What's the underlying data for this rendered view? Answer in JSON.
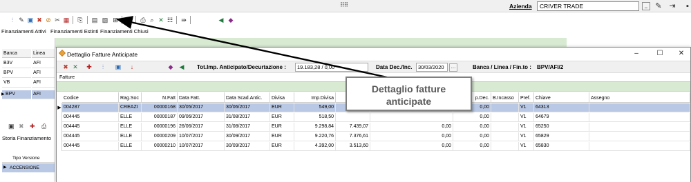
{
  "topbar": {
    "grip": "⠿⠿",
    "azienda_label": "Azienda",
    "azienda_value": "CRIVER TRADE",
    "dropdown_glyph": "_",
    "icons": [
      "edit-icon",
      "exit-icon",
      "more-icon"
    ]
  },
  "tabs": [
    "Finanziamenti Attivi",
    "Finanziamenti Estinti",
    "Finanziamenti Chiusi"
  ],
  "left_grid": {
    "headers": [
      "Banca",
      "Linea"
    ],
    "rows": [
      {
        "banca": "B3V",
        "linea": "AFI"
      },
      {
        "banca": "BPV",
        "linea": "AFI"
      },
      {
        "banca": "VB",
        "linea": "AFI"
      },
      {
        "banca": "BPV",
        "linea": "AFI"
      }
    ],
    "storia_label": "Storia Finanziamento",
    "tipo_header": "Tipo Versione",
    "tipo_value": "ACCENSIONE"
  },
  "dialog": {
    "title": "Dettaglio Fatture Anticipate",
    "tot_label": "Tot.Imp. Anticipato/Decurtazione :",
    "tot_value": "19.183,28 / 0,00",
    "data_label": "Data Dec./Inc.",
    "data_value": "30/03/2020",
    "banca_label": "Banca / Linea / Fin.to :",
    "banca_value": "BPV/AFI/2",
    "fatture_label": "Fatture",
    "columns": [
      "Codice",
      "Rag.Soc",
      "N.Fatt",
      "Data Fatt.",
      "Data Scad.Antic.",
      "Divisa",
      "Imp.Divisa",
      "",
      "",
      "p.Dec.",
      "B.Incasso",
      "Pref.",
      "Chiave",
      "Assegno"
    ],
    "rows": [
      {
        "codice": "004287",
        "ragsoc": "CREAZI",
        "nfatt": "00000168",
        "data_fatt": "30/05/2017",
        "data_scad": "30/06/2017",
        "divisa": "EUR",
        "imp_divisa": "549,00",
        "imp2": "",
        "imp3": "",
        "dec": "0,00",
        "pref": "V1",
        "chiave": "64313"
      },
      {
        "codice": "004445",
        "ragsoc": "ELLE",
        "nfatt": "00000187",
        "data_fatt": "09/06/2017",
        "data_scad": "31/08/2017",
        "divisa": "EUR",
        "imp_divisa": "518,50",
        "imp2": "",
        "imp3": "",
        "dec": "0,00",
        "pref": "V1",
        "chiave": "64679"
      },
      {
        "codice": "004445",
        "ragsoc": "ELLE",
        "nfatt": "00000196",
        "data_fatt": "26/06/2017",
        "data_scad": "31/08/2017",
        "divisa": "EUR",
        "imp_divisa": "9.298,84",
        "imp2": "7.439,07",
        "imp3": "0,00",
        "dec": "0,00",
        "pref": "V1",
        "chiave": "65250"
      },
      {
        "codice": "004445",
        "ragsoc": "ELLE",
        "nfatt": "00000209",
        "data_fatt": "10/07/2017",
        "data_scad": "30/09/2017",
        "divisa": "EUR",
        "imp_divisa": "9.220,76",
        "imp2": "7.376,61",
        "imp3": "0,00",
        "dec": "0,00",
        "pref": "V1",
        "chiave": "65829"
      },
      {
        "codice": "004445",
        "ragsoc": "ELLE",
        "nfatt": "00000210",
        "data_fatt": "10/07/2017",
        "data_scad": "30/09/2017",
        "divisa": "EUR",
        "imp_divisa": "4.392,00",
        "imp2": "3.513,60",
        "imp3": "0,00",
        "dec": "0,00",
        "pref": "V1",
        "chiave": "65830"
      }
    ]
  },
  "annotation": {
    "line1": "Dettaglio fatture",
    "line2": "anticipate"
  },
  "colors": {
    "band_green": "#d9ead3",
    "selection_blue": "#b9c8e4",
    "arrow": "#000000"
  }
}
